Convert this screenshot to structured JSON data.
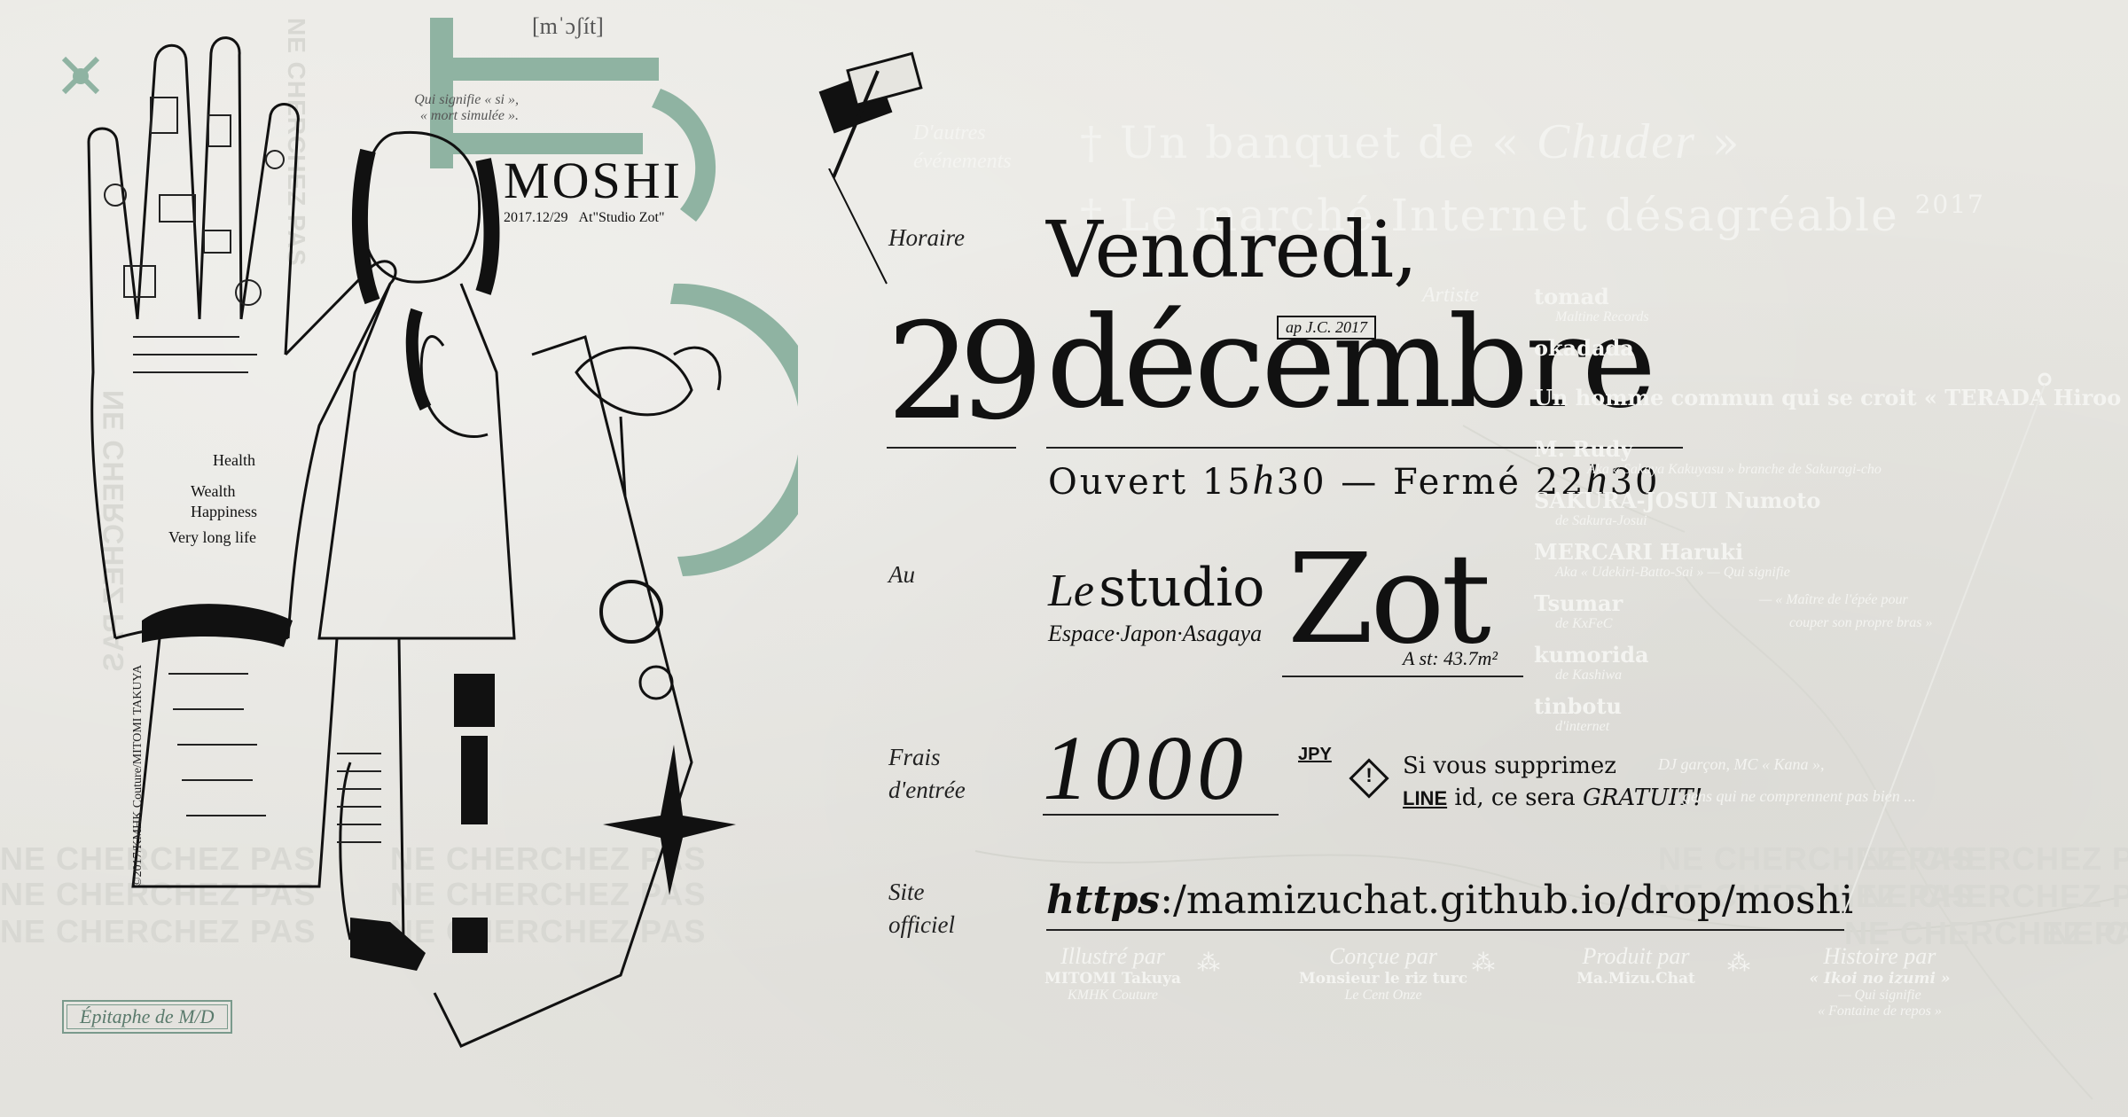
{
  "phonetic": "[mˈɔʃít]",
  "meaning_note": {
    "line1": "Qui signifie « si »,",
    "line2": "« mort simulée »."
  },
  "poster_title": {
    "word": "MOSHI",
    "date": "2017.12/29",
    "venue": "At\"Studio Zot\""
  },
  "badge_bottom_left": "Épitaphe de M/D",
  "copyright": "©2017/KMHK Couture/MITOMI TAKUYA",
  "background_repeat_text": "NE CHERCHEZ PAS",
  "other_events": {
    "label_line1": "D'autres",
    "label_line2": "événements",
    "items": [
      {
        "prefix": "† Un banquet de «",
        "name": "Chuder",
        "suffix": "»"
      },
      {
        "prefix": "† Le marché Internet désagréable",
        "name": "",
        "suffix": "2017"
      }
    ]
  },
  "schedule": {
    "label": "Horaire",
    "weekday": "Vendredi,",
    "era_badge": "ap J.C. 2017",
    "day": "29",
    "month": "décembre",
    "hours": {
      "open_word": "Ouvert",
      "open_h": "15",
      "open_m": "30",
      "sep": "—",
      "close_word": "Fermé",
      "close_h": "22",
      "close_m": "30",
      "h_glyph": "h"
    }
  },
  "venue": {
    "label": "Au",
    "prefix": "Le",
    "name": "studio",
    "big": "Zot",
    "sub": "Espace·Japon·Asagaya",
    "area": "A st: 43.7m²"
  },
  "fee": {
    "label_line1": "Frais",
    "label_line2": "d'entrée",
    "amount": "1000",
    "currency": "JPY",
    "note_line1": "Si vous supprimez",
    "note_line2_a": "LINE",
    "note_line2_b": "id, ce sera",
    "note_line2_c": "GRATUIT!"
  },
  "website": {
    "label_line1": "Site",
    "label_line2": "officiel",
    "scheme": "https",
    "sep": ":/",
    "url": "mamizuchat.github.io/drop/moshi"
  },
  "artists": {
    "label": "Artiste",
    "items": [
      {
        "name": "tomad",
        "sub": "Maltine Records"
      },
      {
        "name": "okadada",
        "sub": ""
      },
      {
        "name": "Un homme commun qui se croit « TERADA Hiroo »",
        "sub": ""
      },
      {
        "name": "M. Rudy",
        "sub": "Aka « Sakaya Kakuyasu » branche de Sakuragi-cho"
      },
      {
        "name": "SAKURA-JOSUI Numoto",
        "sub": "de Sakura-Josui"
      },
      {
        "name": "MERCARI Haruki",
        "sub": "Aka « Udekiri-Batto-Sai » — Qui signifie"
      },
      {
        "name": "Tsumar",
        "sub": "de KxFeC"
      },
      {
        "name": "kumorida",
        "sub": "de Kashiwa"
      },
      {
        "name": "tinbotu",
        "sub": "d'internet"
      }
    ],
    "extra_note": "— « Maître de l'épée pour",
    "extra_note2": "couper son propre bras »",
    "dj_note": "DJ garçon, MC « Kana »,",
    "dj_note2": "gens qui ne comprennent pas bien ..."
  },
  "credits": [
    {
      "role": "Illustré par",
      "name": "MITOMI Takuya",
      "sub": "KMHK Couture",
      "sub2": ""
    },
    {
      "role": "Conçue par",
      "name": "Monsieur le riz turc",
      "sub": "Le Cent Onze",
      "sub2": ""
    },
    {
      "role": "Produit par",
      "name": "Ma.Mizu.Chat",
      "sub": "",
      "sub2": ""
    },
    {
      "role": "Histoire par",
      "name": "« Ikoi no izumi »",
      "sub": "— Qui signifie",
      "sub2": "« Fontaine de repos »"
    }
  ],
  "colors": {
    "background": "#e6e5e0",
    "ink": "#111111",
    "mint": "#8fb3a2",
    "faint": "#f4f4f1"
  }
}
